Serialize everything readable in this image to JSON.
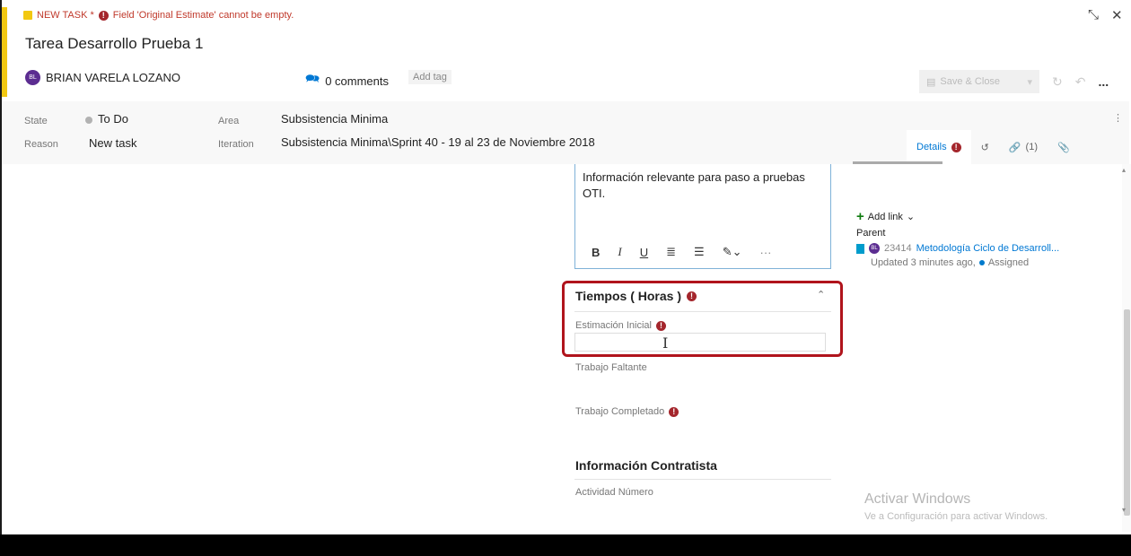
{
  "header": {
    "work_item_type": "NEW TASK *",
    "error_message": "Field 'Original Estimate' cannot be empty.",
    "title": "Tarea Desarrollo Prueba 1",
    "assigned_to": "BRIAN VARELA LOZANO",
    "avatar_initials": "BL",
    "comments": "0 comments",
    "add_tag": "Add tag",
    "save_close": "Save & Close",
    "more": "..."
  },
  "fields": {
    "state_label": "State",
    "state_value": "To Do",
    "reason_label": "Reason",
    "reason_value": "New task",
    "area_label": "Area",
    "area_value": "Subsistencia Minima",
    "iteration_label": "Iteration",
    "iteration_value": "Subsistencia Minima\\Sprint 40 - 19 al 23 de Noviembre 2018"
  },
  "tabs": {
    "details": "Details",
    "links_count": "(1)"
  },
  "description": {
    "text": "Información relevante para paso a pruebas OTI.",
    "bold": "B",
    "italic": "I",
    "underline": "U",
    "more": "···"
  },
  "tiempos": {
    "title": "Tiempos ( Horas )",
    "estimacion_label": "Estimación Inicial",
    "estimacion_value": "",
    "trabajo_faltante_label": "Trabajo Faltante",
    "trabajo_completado_label": "Trabajo Completado"
  },
  "contratista": {
    "title": "Información Contratista",
    "actividad_label": "Actividad Número"
  },
  "related": {
    "add_link": "Add link",
    "parent_label": "Parent",
    "parent_id": "23414",
    "parent_title": "Metodología Ciclo de Desarroll...",
    "updated": "Updated 3 minutes ago,",
    "status": "Assigned"
  },
  "watermark": {
    "line1": "Activar Windows",
    "line2": "Ve a Configuración para activar Windows."
  },
  "colors": {
    "error_red": "#a4262c",
    "accent_blue": "#0078d4",
    "task_yellow": "#f2c811",
    "highlight_red": "#b0141c"
  }
}
